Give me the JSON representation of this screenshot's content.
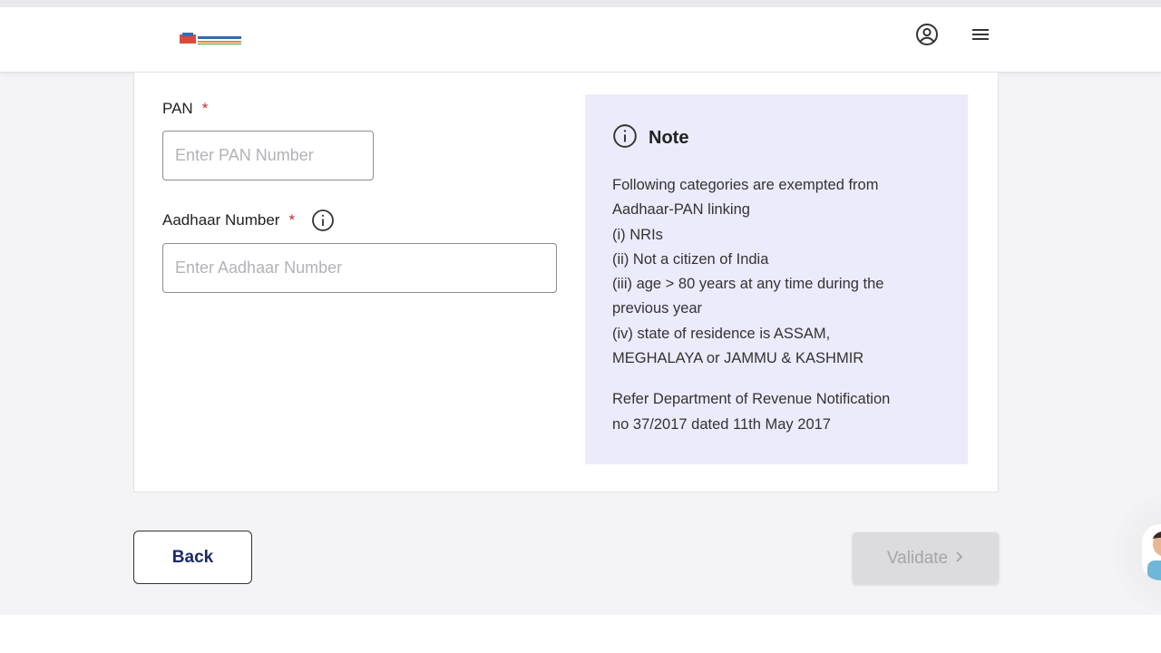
{
  "header": {
    "user_icon": "account-circle-icon",
    "menu_icon": "hamburger-menu-icon"
  },
  "form": {
    "pan": {
      "label": "PAN",
      "required_mark": "*",
      "placeholder": "Enter PAN Number",
      "value": ""
    },
    "aadhaar": {
      "label": "Aadhaar Number",
      "required_mark": "*",
      "info_icon": "info-circle-icon",
      "placeholder": "Enter Aadhaar Number",
      "value": ""
    }
  },
  "note": {
    "icon": "info-circle-icon",
    "title": "Note",
    "lines": [
      "Following categories are exempted from",
      "Aadhaar-PAN linking",
      "(i) NRIs",
      "(ii) Not a citizen of India",
      "(iii) age > 80 years at any time during the",
      "previous year",
      "(iv) state of residence is ASSAM,",
      "MEGHALAYA or JAMMU & KASHMIR"
    ],
    "reference_lines": [
      "Refer Department of Revenue Notification",
      "no 37/2017 dated 11th May 2017"
    ]
  },
  "actions": {
    "back_label": "Back",
    "validate_label": "Validate",
    "validate_disabled": true
  },
  "colors": {
    "note_background": "#ecebfb",
    "required": "#c62828",
    "back_text": "#1c2a6b",
    "validate_disabled_bg": "#dcdcdf"
  }
}
